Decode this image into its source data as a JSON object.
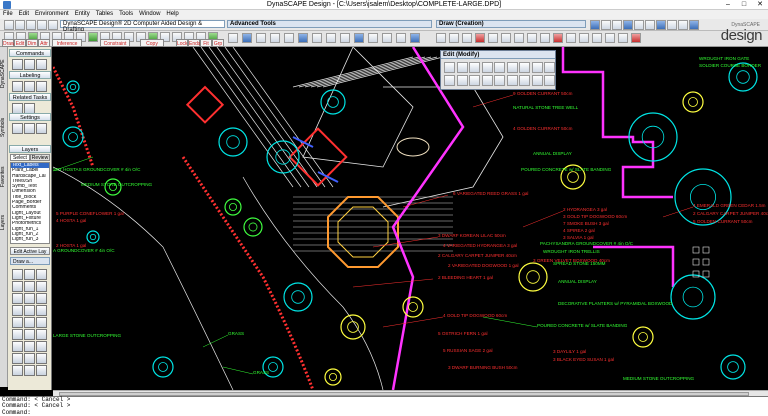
{
  "window": {
    "title": "DynaSCAPE Design  -  [C:\\Users\\jsalem\\Desktop\\COMPLETE-LARGE.DPD]",
    "minimize": "–",
    "maximize": "□",
    "close": "✕"
  },
  "menu": [
    "File",
    "Edit",
    "Environment",
    "Entity",
    "Tables",
    "Tools",
    "Window",
    "Help"
  ],
  "toolbars": {
    "dynascape_label": "DynaSCAPE Design® 2D Computer Aided Design & Drafting",
    "advanced_tools": "Advanced Tools",
    "draw_creation": "Draw (Creation)",
    "edit_modify": "Edit (Modify)"
  },
  "logo": {
    "brand": "design",
    "tagline": "DynaSCAPE"
  },
  "command_buttons": [
    {
      "label": "Draw",
      "color": "#cc2222"
    },
    {
      "label": "Edit",
      "color": "#cc2222"
    },
    {
      "label": "Dim",
      "color": "#cc2222"
    },
    {
      "label": "Attr",
      "color": "#cc2222"
    },
    {
      "label": "Inference",
      "color": "#cc2222"
    },
    {
      "label": "Constraint",
      "color": "#cc2222"
    },
    {
      "label": "Copy",
      "color": "#cc2222"
    },
    {
      "label": "Lock",
      "color": "#cc2222"
    },
    {
      "label": "Ends",
      "color": "#cc2222"
    },
    {
      "label": "Fit",
      "color": "#cc2222"
    },
    {
      "label": "Grp",
      "color": "#cc2222"
    }
  ],
  "sidepanel": {
    "commands": "Commands",
    "labeling": "Labeling",
    "related_tasks": "Related Tasks",
    "settings": "Settings",
    "layers": "Layers",
    "layer_tabs": [
      "Select",
      "Review"
    ],
    "layers_list": [
      "Text_Labels",
      "Plant_Label",
      "Hardscape_Lal",
      "Trees/Sh",
      "Symb_Text",
      "Dimension",
      "Title_Block",
      "Page_Border",
      "Comments",
      "Light_Layout",
      "Light_Fixture",
      "Photometrics",
      "Light_run_1",
      "Light_run_2",
      "Light_run_3"
    ],
    "selected_layer": "Text_Labels",
    "edit_active": "Edit Active Lay",
    "draw_toolbox": "Draw a..."
  },
  "sidetabs": [
    "DynaSCAPE",
    "Symbols",
    "Favorites",
    "Layers"
  ],
  "plan_labels": {
    "red": [
      "9 GOLDEN CURRANT 50cm",
      "4 GOLDEN CURRANT 50cm",
      "6 VARIEGATED REED GRASS 1 gal",
      "3 DWARF KOREAN LILAC 50cm",
      "4 VARIEGATED HYDRANGEA 3 gal",
      "2 CALGARY CARPET JUNIPER 40cm",
      "2 VARIEGATED DOGWOOD 1 gal",
      "2 BLEEDING HEART 1 gal",
      "4 GOLD TIP DOGWOOD 60cm",
      "5 OSTRICH FERN 1 gal",
      "5 RUSSIAN SAGE 2 gal",
      "3 DWARF BURNING BUSH 50cm",
      "2 HYDRANGEA 3 gal",
      "3 GOLD TIP DOGWOOD 60cm",
      "7 SMOKE BUSH 3 gal",
      "4 SPIREA 2 gal",
      "3 SALVIA 1 gal",
      "3 GREEN VELVET BOXWOOD 40cm",
      "4 EMERALD GREEN CEDAR 1.5m",
      "2 CALGARY CARPET JUNIPER 40cm",
      "5 GOLDEN CURRANT 50cm",
      "3 DAYLILY 1 gal",
      "3 BLACK EYED SUSAN 1 gal",
      "5 PURPLE CONEFLOWER 1 gal",
      "4 HOSTA 1 gal",
      "2 HOSTA 1 gal"
    ],
    "green": [
      "NATURAL STONE TREE WELL",
      "ANNUAL DISPLAY",
      "POURED CONCRETE w/ SLATE BANDING",
      "PACHYSANDRA GROUNDCOVER # 4in O/C",
      "WROUGHT IRON TRELLIS",
      "SPREAD STONE 150MM",
      "ANNUAL DISPLAY",
      "DECORATIVE PLANTERS w/ PYRAMIDAL BOXWOOD",
      "POURED CONCRETE w/ SLATE BANDING",
      "WROUGHT IRON GATE",
      "SOLDIER COURSE BORDER",
      "GRASS",
      "GRASS",
      "SET HOSTAS GROUNDCOVER # 4in O/C",
      "MEDIUM STONE OUTCROPPING",
      "A GROUNDCOVER # 4in O/C",
      "LARGE STONE OUTCROPPING",
      "MEDIUM STONE OUTCROPPING"
    ]
  },
  "command_lines": [
    "Command: < Cancel >",
    "Command: < Cancel >",
    "Command:"
  ],
  "colors": {
    "magenta_boundary": "#ff33ff",
    "label_red": "#ff3030",
    "label_green": "#33ff33",
    "plant_cyan": "#00e5e5",
    "hardscape_white": "#e8e8e8"
  }
}
